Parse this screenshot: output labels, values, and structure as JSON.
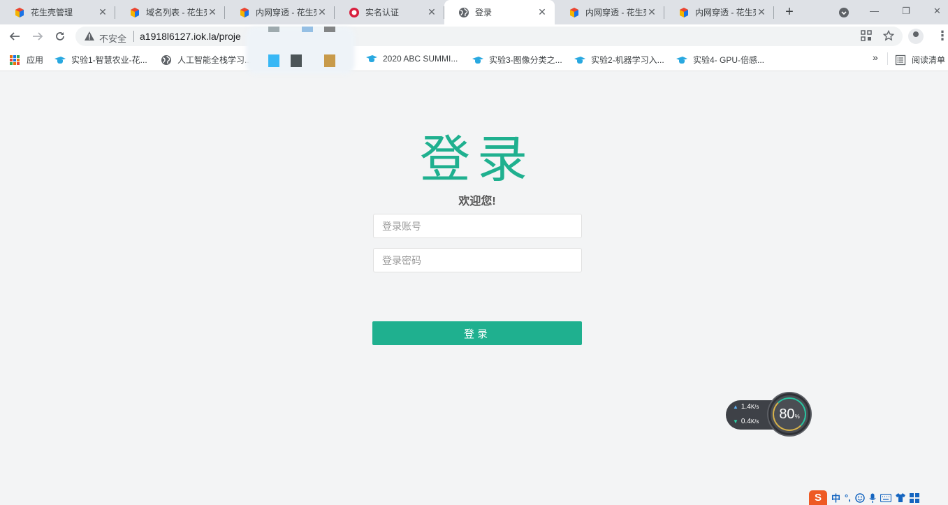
{
  "browser": {
    "tabs": [
      {
        "title": "花生壳管理",
        "favicon": "cube-icon",
        "active": false
      },
      {
        "title": "域名列表 - 花生壳",
        "favicon": "cube-icon",
        "active": false
      },
      {
        "title": "内网穿透 - 花生壳",
        "favicon": "cube-icon",
        "active": false
      },
      {
        "title": "实名认证",
        "favicon": "red-circle-icon",
        "active": false
      },
      {
        "title": "登录",
        "favicon": "globe-icon",
        "active": true
      },
      {
        "title": "内网穿透 - 花生壳",
        "favicon": "cube-icon",
        "active": false
      },
      {
        "title": "内网穿透 - 花生壳",
        "favicon": "cube-icon",
        "active": false
      }
    ],
    "new_tab": "+",
    "address": {
      "security_label": "不安全",
      "url": "a1918l6127.iok.la/proje"
    },
    "bookmarks": [
      {
        "label": "应用",
        "icon": "apps-icon"
      },
      {
        "label": "实验1-智慧农业-花...",
        "icon": "mortarboard-icon"
      },
      {
        "label": "人工智能全栈学习...",
        "icon": "globe-icon"
      },
      {
        "label": "2020 ABC SUMMI...",
        "icon": "mortarboard-icon"
      },
      {
        "label": "实验3-图像分类之...",
        "icon": "mortarboard-icon"
      },
      {
        "label": "实验2-机器学习入...",
        "icon": "mortarboard-icon"
      },
      {
        "label": "实验4- GPU-倍感...",
        "icon": "mortarboard-icon"
      }
    ],
    "more_bookmarks": "»",
    "reading_list": "阅读清单"
  },
  "login": {
    "title": "登录",
    "welcome": "欢迎您!",
    "account_placeholder": "登录账号",
    "password_placeholder": "登录密码",
    "submit_label": "登录"
  },
  "speed_widget": {
    "upload": "1.4",
    "download": "0.4",
    "unit": "K/s",
    "percent": "80",
    "percent_unit": "%"
  },
  "ime": {
    "logo": "S",
    "mode": "中",
    "punct": "°,"
  },
  "colors": {
    "accent": "#1fb08f",
    "background": "#f3f4f5"
  }
}
